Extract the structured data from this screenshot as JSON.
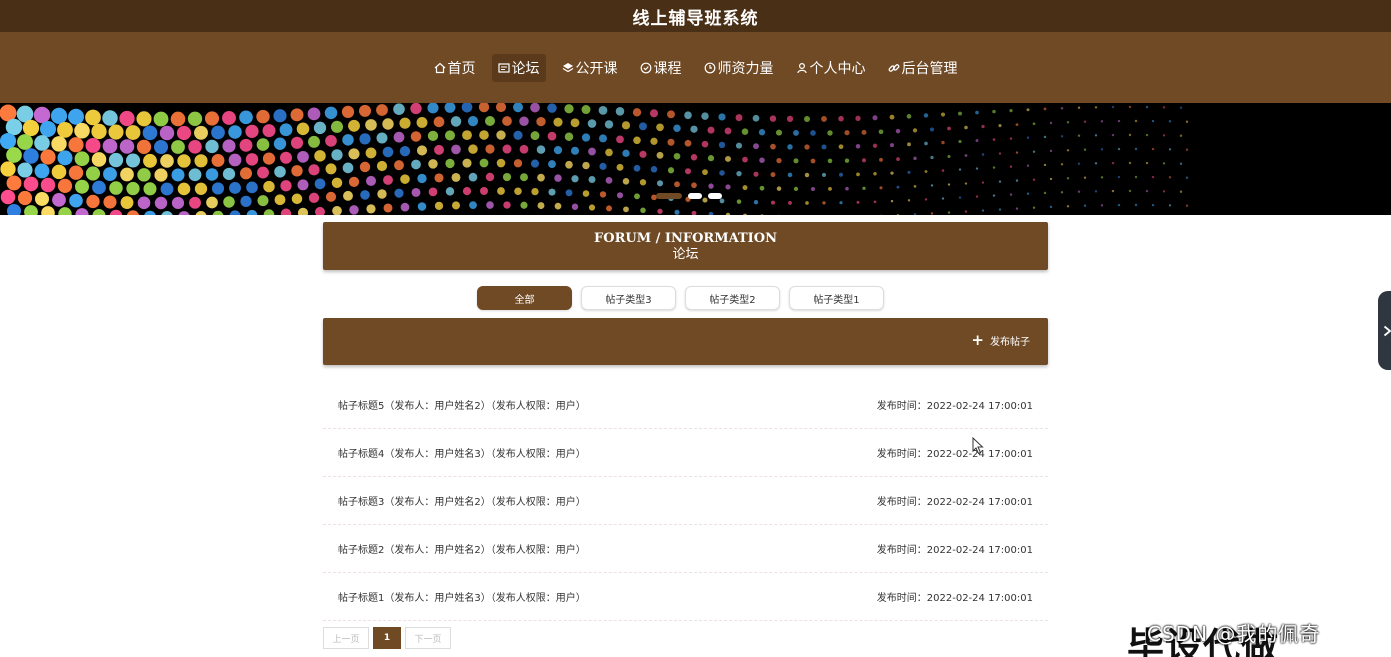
{
  "app": {
    "title": "线上辅导班系统"
  },
  "nav": {
    "items": [
      {
        "label": "首页",
        "icon": "home-icon"
      },
      {
        "label": "论坛",
        "icon": "forum-icon",
        "active": true
      },
      {
        "label": "公开课",
        "icon": "layers-icon"
      },
      {
        "label": "课程",
        "icon": "course-icon"
      },
      {
        "label": "师资力量",
        "icon": "clock-icon"
      },
      {
        "label": "个人中心",
        "icon": "user-icon"
      },
      {
        "label": "后台管理",
        "icon": "link-icon"
      }
    ]
  },
  "banner": {
    "slides": 3,
    "active_slide": 1
  },
  "forum": {
    "heading_en": "FORUM / INFORMATION",
    "heading_cn": "论坛",
    "tabs": [
      "全部",
      "帖子类型3",
      "帖子类型2",
      "帖子类型1"
    ],
    "active_tab": "全部",
    "post_button": "发布帖子",
    "posts": [
      {
        "text": "帖子标题5（发布人：用户姓名2）（发布人权限：用户）",
        "time": "发布时间：2022-02-24 17:00:01"
      },
      {
        "text": "帖子标题4（发布人：用户姓名3）（发布人权限：用户）",
        "time": "发布时间：2022-02-24 17:00:01"
      },
      {
        "text": "帖子标题3（发布人：用户姓名2）（发布人权限：用户）",
        "time": "发布时间：2022-02-24 17:00:01"
      },
      {
        "text": "帖子标题2（发布人：用户姓名2）（发布人权限：用户）",
        "time": "发布时间：2022-02-24 17:00:01"
      },
      {
        "text": "帖子标题1（发布人：用户姓名3）（发布人权限：用户）",
        "time": "发布时间：2022-02-24 17:00:01"
      }
    ]
  },
  "pagination": {
    "prev": "上一页",
    "current": "1",
    "next": "下一页"
  },
  "watermark": {
    "large": "毕设代做",
    "credit": "CSDN @我的佩奇"
  },
  "colors": {
    "primary": "#6f4a25",
    "topbar": "#4a2f17"
  }
}
